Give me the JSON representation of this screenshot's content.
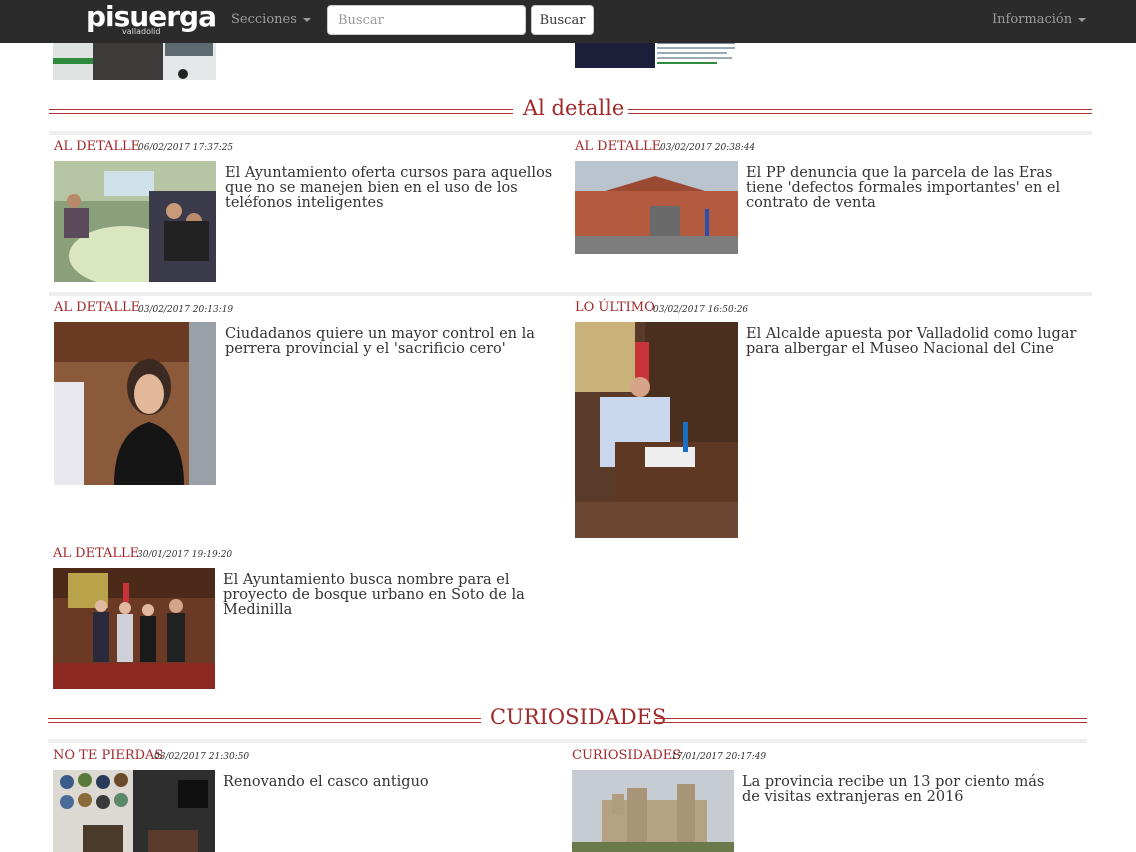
{
  "navbar": {
    "logo_text": "pisuerga",
    "logo_subtext": "valladolid",
    "menu_sections": "Secciones",
    "search_placeholder": "Buscar",
    "search_button": "Buscar",
    "menu_info": "Información"
  },
  "sections": [
    {
      "title": "Al detalle"
    },
    {
      "title": "CURIOSIDADES"
    }
  ],
  "articles": [
    {
      "category": "AL DETALLE",
      "date": "06/02/2017 17:37:25",
      "headline": "El Ayuntamiento oferta cursos para aquellos que no se manejen bien en el uso de los teléfonos inteligentes"
    },
    {
      "category": "AL DETALLE",
      "date": "03/02/2017 20:38:44",
      "headline": "El PP denuncia que la parcela de las Eras tiene 'defectos formales importantes' en el contrato de venta"
    },
    {
      "category": "AL DETALLE",
      "date": "03/02/2017 20:13:19",
      "headline": "Ciudadanos quiere un mayor control en la perrera provincial y el 'sacrificio cero'"
    },
    {
      "category": "LO ÚLTIMO",
      "date": "03/02/2017 16:50:26",
      "headline": "El Alcalde apuesta por Valladolid como lugar para albergar el Museo Nacional del Cine"
    },
    {
      "category": "AL DETALLE",
      "date": "30/01/2017 19:19:20",
      "headline": "El Ayuntamiento busca nombre para el proyecto de bosque urbano en Soto de la Medinilla"
    },
    {
      "category": "NO TE PIERDAS",
      "date": "03/02/2017 21:30:50",
      "headline": "Renovando el casco antiguo"
    },
    {
      "category": "CURIOSIDADES",
      "date": "17/01/2017 20:17:49",
      "headline": "La provincia recibe un 13 por ciento más de visitas extranjeras en 2016"
    }
  ],
  "colors": {
    "accent": "#a0282a",
    "navbar": "#2b2b2b"
  }
}
